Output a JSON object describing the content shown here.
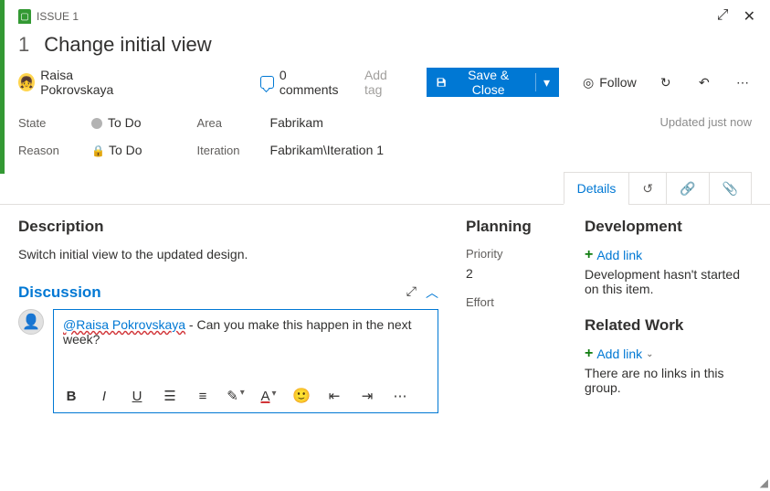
{
  "header": {
    "issue_label": "ISSUE 1",
    "id": "1",
    "title": "Change initial view"
  },
  "assignee": {
    "name": "Raisa Pokrovskaya"
  },
  "comments": {
    "count_label": "0 comments"
  },
  "addtag": "Add tag",
  "save_button": "Save & Close",
  "follow": "Follow",
  "updated": "Updated just now",
  "fields": {
    "state_label": "State",
    "state_value": "To Do",
    "reason_label": "Reason",
    "reason_value": "To Do",
    "area_label": "Area",
    "area_value": "Fabrikam",
    "iteration_label": "Iteration",
    "iteration_value": "Fabrikam\\Iteration 1"
  },
  "tabs": {
    "details": "Details"
  },
  "description": {
    "title": "Description",
    "text": "Switch initial view to the updated design."
  },
  "discussion": {
    "title": "Discussion",
    "mention": "@Raisa Pokrovskaya",
    "rest": " - Can you make this happen in the next week?"
  },
  "planning": {
    "title": "Planning",
    "priority_label": "Priority",
    "priority_value": "2",
    "effort_label": "Effort"
  },
  "development": {
    "title": "Development",
    "add_link": "Add link",
    "hint": "Development hasn't started on this item."
  },
  "related": {
    "title": "Related Work",
    "add_link": "Add link",
    "hint": "There are no links in this group."
  }
}
